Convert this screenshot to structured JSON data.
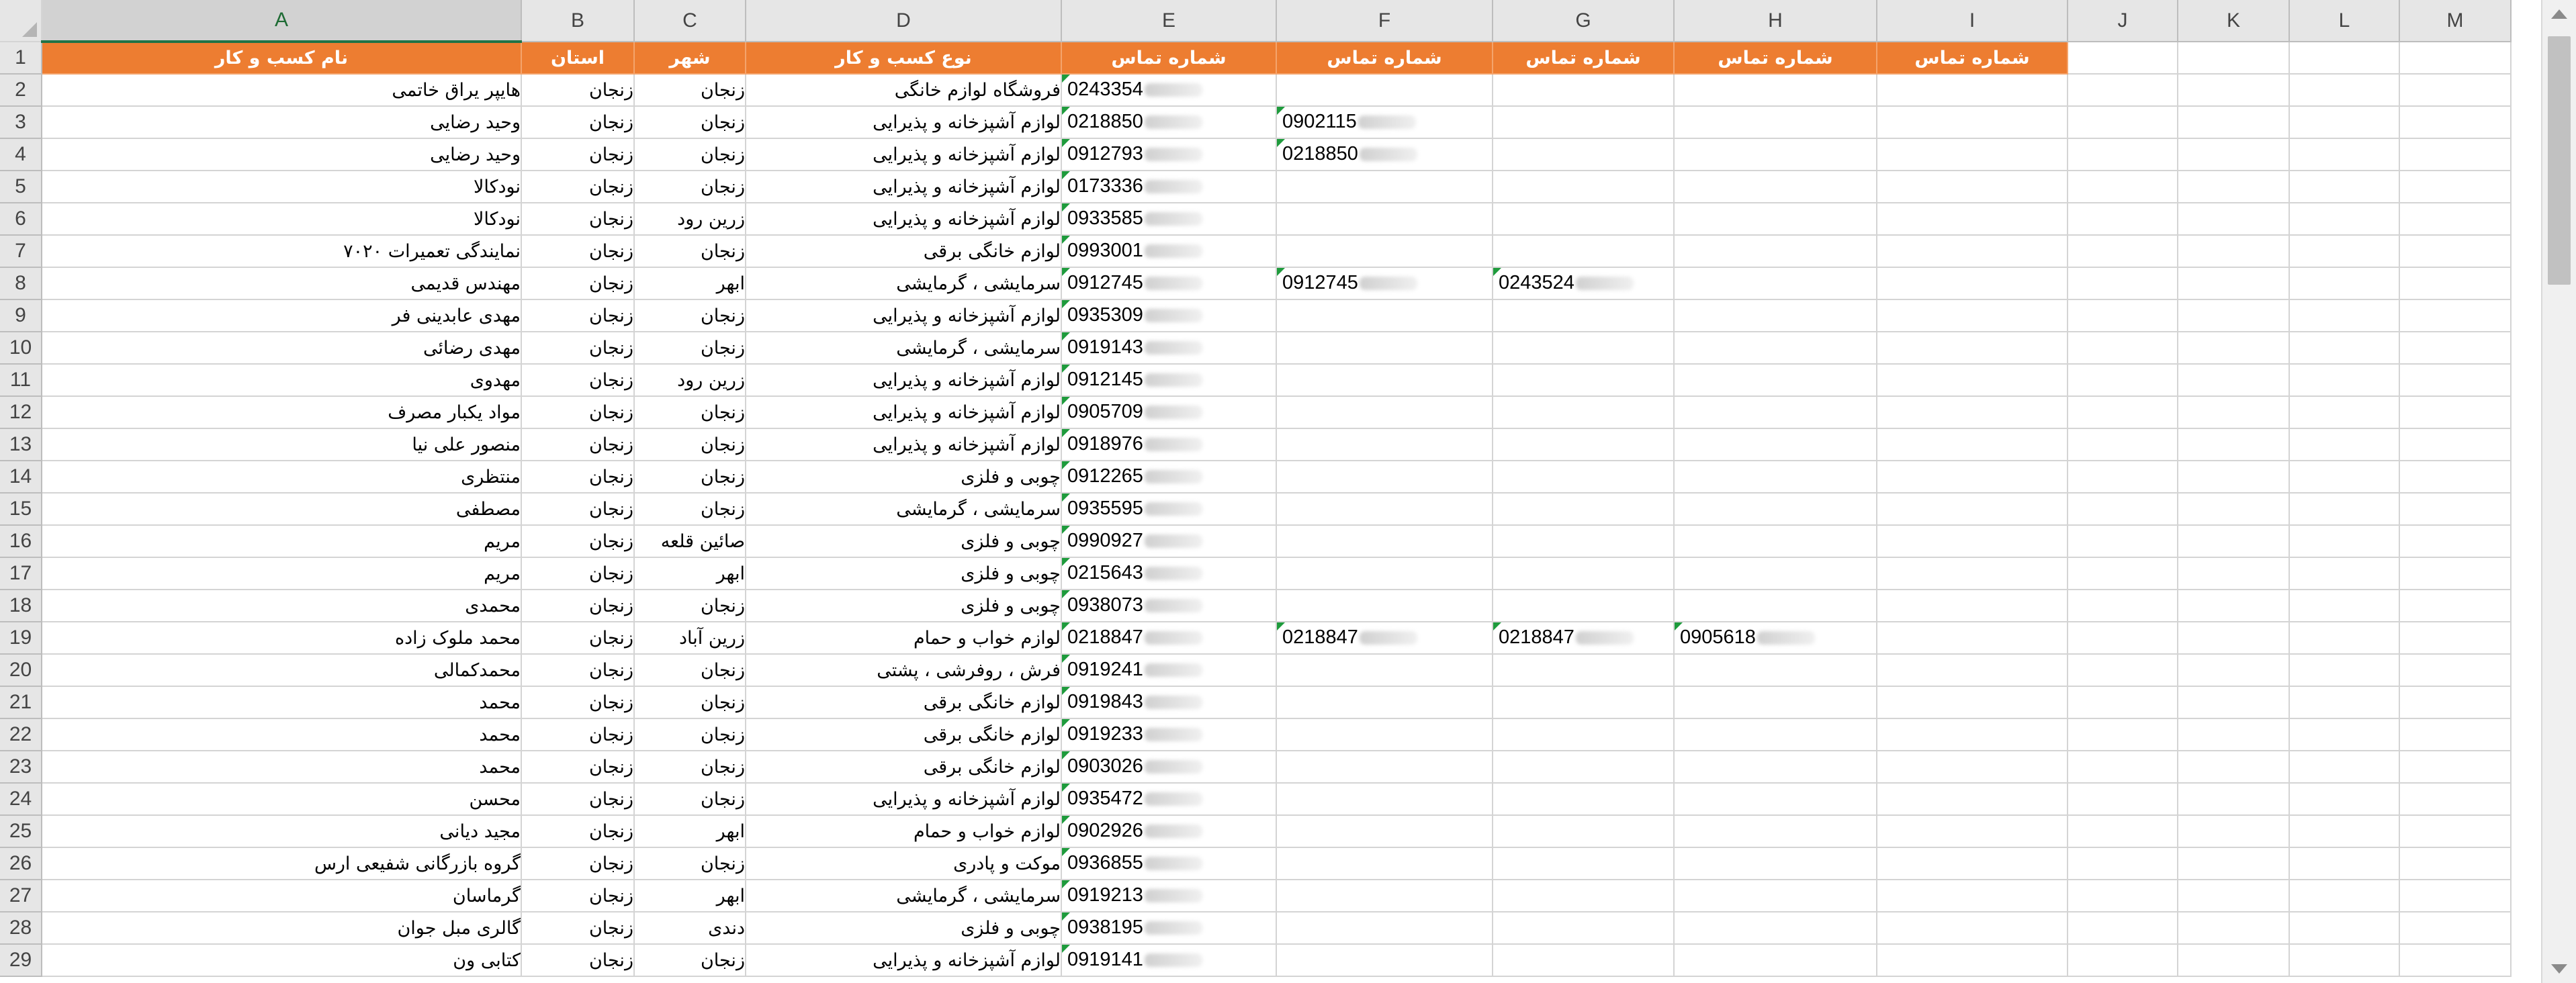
{
  "columns": [
    "A",
    "B",
    "C",
    "D",
    "E",
    "F",
    "G",
    "H",
    "I",
    "J",
    "K",
    "L",
    "M"
  ],
  "selected_column": "A",
  "header_row": {
    "A": "نام کسب و کار",
    "B": "استان",
    "C": "شهر",
    "D": "نوع کسب و کار",
    "E": "شماره تماس",
    "F": "شماره تماس",
    "G": "شماره تماس",
    "H": "شماره تماس",
    "I": "شماره تماس"
  },
  "rows": [
    {
      "n": "2",
      "A": "هایپر یراق خاتمی",
      "B": "زنجان",
      "C": "زنجان",
      "D": "فروشگاه لوازم خانگی",
      "E": "0243354"
    },
    {
      "n": "3",
      "A": "وحید رضایی",
      "B": "زنجان",
      "C": "زنجان",
      "D": "لوازم آشپزخانه و پذیرایی",
      "E": "0218850",
      "F": "0902115"
    },
    {
      "n": "4",
      "A": "وحید رضایی",
      "B": "زنجان",
      "C": "زنجان",
      "D": "لوازم آشپزخانه و پذیرایی",
      "E": "0912793",
      "F": "0218850"
    },
    {
      "n": "5",
      "A": "نودکالا",
      "B": "زنجان",
      "C": "زنجان",
      "D": "لوازم آشپزخانه و پذیرایی",
      "E": "0173336"
    },
    {
      "n": "6",
      "A": "نودکالا",
      "B": "زنجان",
      "C": "زرین رود",
      "D": "لوازم آشپزخانه و پذیرایی",
      "E": "0933585"
    },
    {
      "n": "7",
      "A": "نمایندگی تعمیرات ۷۰۲۰",
      "B": "زنجان",
      "C": "زنجان",
      "D": "لوازم خانگی برقی",
      "E": "0993001"
    },
    {
      "n": "8",
      "A": "مهندس قدیمی",
      "B": "زنجان",
      "C": "ابهر",
      "D": "سرمایشی ، گرمایشی",
      "E": "0912745",
      "F": "0912745",
      "G": "0243524"
    },
    {
      "n": "9",
      "A": "مهدی عابدینی فر",
      "B": "زنجان",
      "C": "زنجان",
      "D": "لوازم آشپزخانه و پذیرایی",
      "E": "0935309"
    },
    {
      "n": "10",
      "A": "مهدی رضائی",
      "B": "زنجان",
      "C": "زنجان",
      "D": "سرمایشی ، گرمایشی",
      "E": "0919143"
    },
    {
      "n": "11",
      "A": "مهدوی",
      "B": "زنجان",
      "C": "زرین رود",
      "D": "لوازم آشپزخانه و پذیرایی",
      "E": "0912145"
    },
    {
      "n": "12",
      "A": "مواد یکبار مصرف",
      "B": "زنجان",
      "C": "زنجان",
      "D": "لوازم آشپزخانه و پذیرایی",
      "E": "0905709"
    },
    {
      "n": "13",
      "A": "منصور علی نیا",
      "B": "زنجان",
      "C": "زنجان",
      "D": "لوازم آشپزخانه و پذیرایی",
      "E": "0918976"
    },
    {
      "n": "14",
      "A": "منتظری",
      "B": "زنجان",
      "C": "زنجان",
      "D": "چوبی و فلزی",
      "E": "0912265"
    },
    {
      "n": "15",
      "A": "مصطفی",
      "B": "زنجان",
      "C": "زنجان",
      "D": "سرمایشی ، گرمایشی",
      "E": "0935595"
    },
    {
      "n": "16",
      "A": "مریم",
      "B": "زنجان",
      "C": "صائین قلعه",
      "D": "چوبی و فلزی",
      "E": "0990927"
    },
    {
      "n": "17",
      "A": "مریم",
      "B": "زنجان",
      "C": "ابهر",
      "D": "چوبی و فلزی",
      "E": "0215643"
    },
    {
      "n": "18",
      "A": "محمدی",
      "B": "زنجان",
      "C": "زنجان",
      "D": "چوبی و فلزی",
      "E": "0938073"
    },
    {
      "n": "19",
      "A": "محمد ملوک زاده",
      "B": "زنجان",
      "C": "زرین آباد",
      "D": "لوازم خواب و حمام",
      "E": "0218847",
      "F": "0218847",
      "G": "0218847",
      "H": "0905618"
    },
    {
      "n": "20",
      "A": "محمدکمالی",
      "B": "زنجان",
      "C": "زنجان",
      "D": "فرش ، روفرشی ، پشتی",
      "E": "0919241"
    },
    {
      "n": "21",
      "A": "محمد",
      "B": "زنجان",
      "C": "زنجان",
      "D": "لوازم خانگی برقی",
      "E": "0919843"
    },
    {
      "n": "22",
      "A": "محمد",
      "B": "زنجان",
      "C": "زنجان",
      "D": "لوازم خانگی برقی",
      "E": "0919233"
    },
    {
      "n": "23",
      "A": "محمد",
      "B": "زنجان",
      "C": "زنجان",
      "D": "لوازم خانگی برقی",
      "E": "0903026"
    },
    {
      "n": "24",
      "A": "محسن",
      "B": "زنجان",
      "C": "زنجان",
      "D": "لوازم آشپزخانه و پذیرایی",
      "E": "0935472"
    },
    {
      "n": "25",
      "A": "مجید دیانی",
      "B": "زنجان",
      "C": "ابهر",
      "D": "لوازم خواب و حمام",
      "E": "0902926"
    },
    {
      "n": "26",
      "A": "گروه بازرگانی شفیعی ارس",
      "B": "زنجان",
      "C": "زنجان",
      "D": "موکت و پادری",
      "E": "0936855"
    },
    {
      "n": "27",
      "A": "گرماسان",
      "B": "زنجان",
      "C": "ابهر",
      "D": "سرمایشی ، گرمایشی",
      "E": "0919213"
    },
    {
      "n": "28",
      "A": "گالری مبل جوان",
      "B": "زنجان",
      "C": "دندی",
      "D": "چوبی و فلزی",
      "E": "0938195"
    },
    {
      "n": "29",
      "A": "کتابی ون",
      "B": "زنجان",
      "C": "زنجان",
      "D": "لوازم آشپزخانه و پذیرایی",
      "E": "0919141"
    }
  ],
  "colors": {
    "header_fill": "#ed7d31",
    "header_text": "#ffffff",
    "indicator": "#1e9b3c",
    "selected_col": "#217346"
  }
}
